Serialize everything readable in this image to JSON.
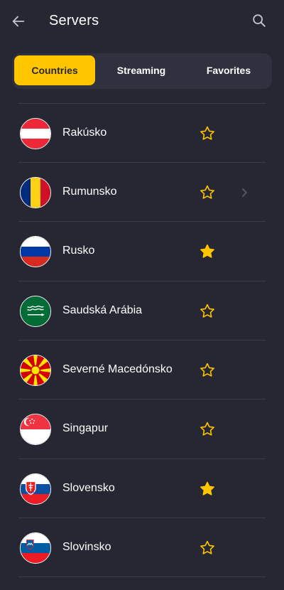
{
  "header": {
    "title": "Servers"
  },
  "tabs": [
    {
      "label": "Countries",
      "active": true
    },
    {
      "label": "Streaming",
      "active": false
    },
    {
      "label": "Favorites",
      "active": false
    }
  ],
  "countries": [
    {
      "name": "Rakúsko",
      "flag": "austria-flag",
      "favorite": false
    },
    {
      "name": "Rumunsko",
      "flag": "romania-flag",
      "favorite": false,
      "chevron": true
    },
    {
      "name": "Rusko",
      "flag": "russia-flag",
      "favorite": true
    },
    {
      "name": "Saudská Arábia",
      "flag": "saudi-arabia-flag",
      "favorite": false
    },
    {
      "name": "Severné Macedónsko",
      "flag": "north-macedonia-flag",
      "favorite": false
    },
    {
      "name": "Singapur",
      "flag": "singapore-flag",
      "favorite": false
    },
    {
      "name": "Slovensko",
      "flag": "slovakia-flag",
      "favorite": true
    },
    {
      "name": "Slovinsko",
      "flag": "slovenia-flag",
      "favorite": false
    }
  ],
  "colors": {
    "background": "#262733",
    "accent": "#ffc600",
    "tab_bar": "#30313e",
    "divider": "#3c3d4a",
    "icon": "#c3c3cf"
  }
}
